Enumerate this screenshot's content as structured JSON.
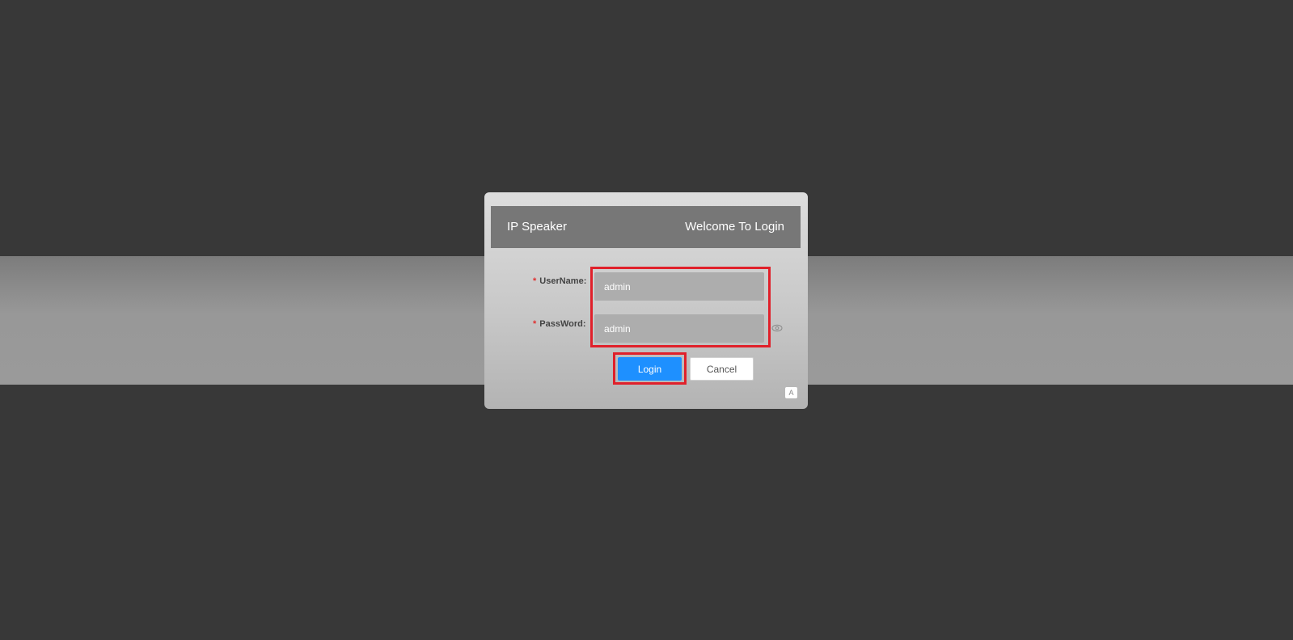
{
  "dialog": {
    "app_title": "IP Speaker",
    "welcome": "Welcome To Login"
  },
  "form": {
    "required_mark": "*",
    "username_label": "UserName:",
    "username_value": "admin",
    "password_label": "PassWord:",
    "password_value": "admin",
    "login_label": "Login",
    "cancel_label": "Cancel"
  },
  "icons": {
    "password_toggle": "eye-icon",
    "language_switch": "translate-icon"
  },
  "colors": {
    "primary_button": "#1e90ff",
    "highlight": "#e0202a",
    "required": "#e03030"
  }
}
